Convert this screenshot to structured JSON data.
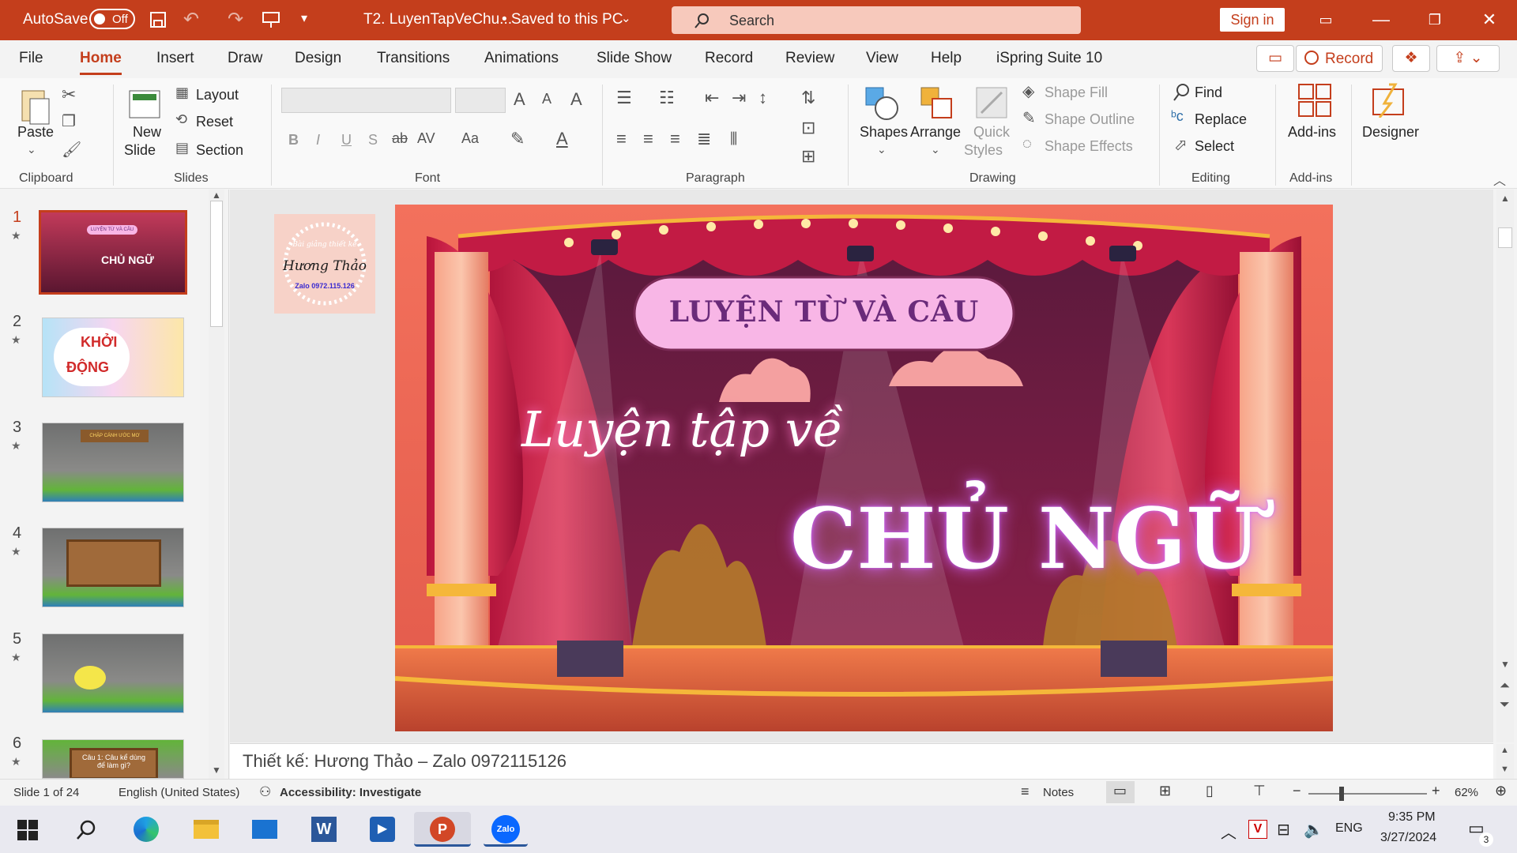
{
  "titlebar": {
    "autosave_label": "AutoSave",
    "autosave_state": "Off",
    "doc_title": "T2. LuyenTapVeChu...",
    "save_status": "• Saved to this PC",
    "search_placeholder": "Search",
    "sign_in": "Sign in"
  },
  "tabs": [
    "File",
    "Home",
    "Insert",
    "Draw",
    "Design",
    "Transitions",
    "Animations",
    "Slide Show",
    "Record",
    "Review",
    "View",
    "Help",
    "iSpring Suite 10"
  ],
  "record_button": "Record",
  "ribbon": {
    "clipboard": {
      "paste": "Paste",
      "group": "Clipboard"
    },
    "slides": {
      "new_slide_1": "New",
      "new_slide_2": "Slide",
      "layout": "Layout",
      "reset": "Reset",
      "section": "Section",
      "group": "Slides"
    },
    "font": {
      "bold": "B",
      "italic": "I",
      "underline": "U",
      "strike": "S",
      "group": "Font"
    },
    "paragraph": {
      "group": "Paragraph"
    },
    "drawing": {
      "shapes": "Shapes",
      "arrange": "Arrange",
      "quick_styles_1": "Quick",
      "quick_styles_2": "Styles",
      "shape_fill": "Shape Fill",
      "shape_outline": "Shape Outline",
      "shape_effects": "Shape Effects",
      "group": "Drawing"
    },
    "editing": {
      "find": "Find",
      "replace": "Replace",
      "select": "Select",
      "group": "Editing"
    },
    "addins": {
      "label": "Add-ins",
      "group": "Add-ins"
    },
    "designer": {
      "label": "Designer"
    }
  },
  "thumbnails": [
    {
      "num": "1",
      "text1": "LUYỆN TỪ VÀ CÂU",
      "text2": "CHỦ NGỮ"
    },
    {
      "num": "2",
      "text1": "KHỞI",
      "text2": "ĐỘNG"
    },
    {
      "num": "3",
      "text1": "CHẶP CÁNH ƯỚC MƠ",
      "text2": ""
    },
    {
      "num": "4",
      "text1": "",
      "text2": ""
    },
    {
      "num": "5",
      "text1": "",
      "text2": ""
    },
    {
      "num": "6",
      "text1": "Câu 1: Câu kể dùng",
      "text2": "để làm gì?"
    }
  ],
  "logo": {
    "line1": "Bài giảng thiết kế",
    "line2": "Hương Thảo",
    "line3": "Zalo 0972.115.126"
  },
  "slide": {
    "banner": "LUYỆN TỪ VÀ CÂU",
    "subtitle": "Luyện tập về",
    "title": "CHỦ NGỮ"
  },
  "notes": "Thiết kế: Hương Thảo – Zalo 0972115126",
  "status": {
    "slide_count": "Slide 1 of 24",
    "language": "English (United States)",
    "accessibility": "Accessibility: Investigate",
    "notes": "Notes",
    "zoom": "62%"
  },
  "taskbar": {
    "time": "9:35 PM",
    "date": "3/27/2024",
    "lang": "ENG",
    "notif": "3"
  },
  "colors": {
    "accent": "#c43e1c",
    "banner": "#f8b6e6",
    "stage": "#7a1c3a"
  }
}
